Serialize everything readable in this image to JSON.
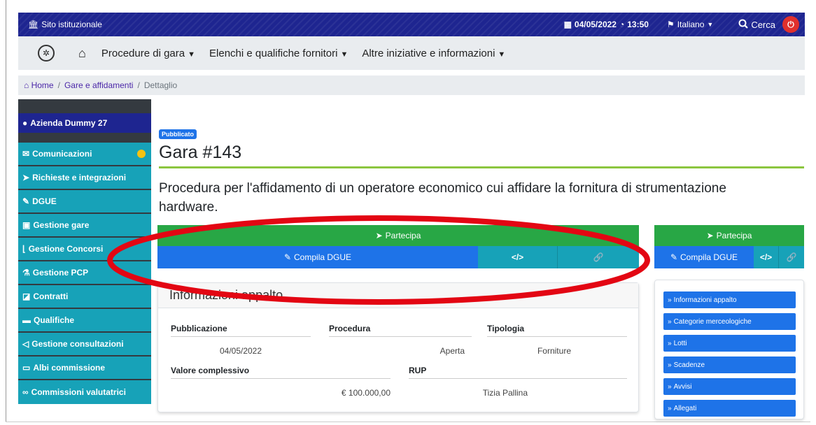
{
  "topbar": {
    "institutional": "Sito istituzionale",
    "date": "04/05/2022",
    "time": "13:50",
    "language": "Italiano",
    "search": "Cerca"
  },
  "nav": {
    "items": [
      {
        "label": "Procedure di gara"
      },
      {
        "label": "Elenchi e qualifiche fornitori"
      },
      {
        "label": "Altre iniziative e informazioni"
      }
    ]
  },
  "breadcrumb": {
    "home": "Home",
    "level1": "Gare e affidamenti",
    "current": "Dettaglio"
  },
  "sidebar": {
    "user": "Azienda Dummy 27",
    "items": [
      {
        "label": "Comunicazioni",
        "icon": "envelope-icon"
      },
      {
        "label": "Richieste e integrazioni",
        "icon": "paper-plane-icon"
      },
      {
        "label": "DGUE",
        "icon": "edit-icon"
      },
      {
        "label": "Gestione gare",
        "icon": "briefcase-icon"
      },
      {
        "label": "Gestione Concorsi",
        "icon": "ruler-icon"
      },
      {
        "label": "Gestione PCP",
        "icon": "flask-icon"
      },
      {
        "label": "Contratti",
        "icon": "contract-icon"
      },
      {
        "label": "Qualifiche",
        "icon": "folder-icon"
      },
      {
        "label": "Gestione consultazioni",
        "icon": "megaphone-icon"
      },
      {
        "label": "Albi commissione",
        "icon": "folder-open-icon"
      },
      {
        "label": "Commissioni valutatrici",
        "icon": "glasses-icon"
      }
    ]
  },
  "page": {
    "badge": "Pubblicato",
    "title": "Gara #143",
    "description": "Procedura per l'affidamento di un operatore economico cui affidare la fornitura di strumentazione hardware."
  },
  "actions": {
    "partecipa": "Partecipa",
    "compila": "Compila DGUE"
  },
  "info": {
    "header": "Informazioni appalto",
    "pubblicazione_label": "Pubblicazione",
    "pubblicazione_value": "04/05/2022",
    "procedura_label": "Procedura",
    "procedura_value": "Aperta",
    "tipologia_label": "Tipologia",
    "tipologia_value": "Forniture",
    "valore_label": "Valore complessivo",
    "valore_value": "€ 100.000,00",
    "rup_label": "RUP",
    "rup_value": "Tizia Pallina"
  },
  "side_links": [
    {
      "label": "Informazioni appalto"
    },
    {
      "label": "Categorie merceologiche"
    },
    {
      "label": "Lotti"
    },
    {
      "label": "Scadenze"
    },
    {
      "label": "Avvisi"
    },
    {
      "label": "Allegati"
    }
  ],
  "colors": {
    "topbar": "#1e2590",
    "accent_green": "#28a745",
    "accent_blue": "#1e73e8",
    "teal": "#17a2b8",
    "annotation": "#e30613"
  }
}
